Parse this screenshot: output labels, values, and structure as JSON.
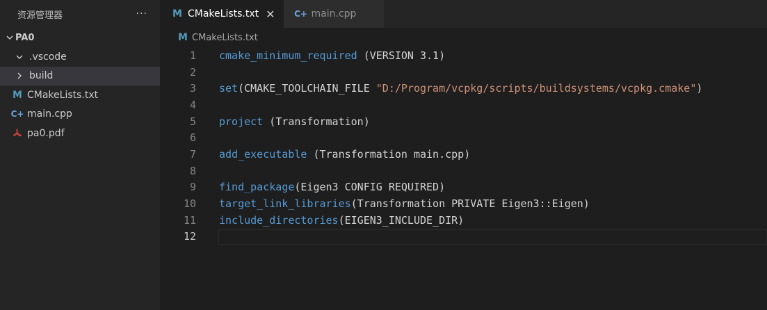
{
  "sidebar": {
    "title": "资源管理器",
    "more_label": "···",
    "folder_name": "PA0",
    "items": [
      {
        "label": ".vscode",
        "type": "folder"
      },
      {
        "label": "build",
        "type": "folder"
      },
      {
        "label": "CMakeLists.txt",
        "icon": "M"
      },
      {
        "label": "main.cpp",
        "icon": "C+"
      },
      {
        "label": "pa0.pdf",
        "icon": "pdf-icon"
      }
    ]
  },
  "tabs": [
    {
      "label": "CMakeLists.txt",
      "icon": "M",
      "active": true
    },
    {
      "label": "main.cpp",
      "icon": "C+",
      "active": false
    }
  ],
  "breadcrumb": {
    "label": "CMakeLists.txt",
    "icon": "M"
  },
  "editor": {
    "current_line": 12,
    "lines": [
      {
        "n": "1",
        "parts": [
          {
            "t": "cmake_minimum_required",
            "c": "kw"
          },
          {
            "t": " (VERSION 3.1)",
            "c": ""
          }
        ]
      },
      {
        "n": "2",
        "parts": []
      },
      {
        "n": "3",
        "parts": [
          {
            "t": "set",
            "c": "kw"
          },
          {
            "t": "(CMAKE_TOOLCHAIN_FILE ",
            "c": ""
          },
          {
            "t": "\"D:/Program/vcpkg/scripts/buildsystems/vcpkg.cmake\"",
            "c": "str"
          },
          {
            "t": ")",
            "c": ""
          }
        ]
      },
      {
        "n": "4",
        "parts": []
      },
      {
        "n": "5",
        "parts": [
          {
            "t": "project",
            "c": "kw"
          },
          {
            "t": " (Transformation)",
            "c": ""
          }
        ]
      },
      {
        "n": "6",
        "parts": []
      },
      {
        "n": "7",
        "parts": [
          {
            "t": "add_executable",
            "c": "kw"
          },
          {
            "t": " (Transformation main.cpp)",
            "c": ""
          }
        ]
      },
      {
        "n": "8",
        "parts": []
      },
      {
        "n": "9",
        "parts": [
          {
            "t": "find_package",
            "c": "kw"
          },
          {
            "t": "(Eigen3 CONFIG REQUIRED)",
            "c": ""
          }
        ]
      },
      {
        "n": "10",
        "parts": [
          {
            "t": "target_link_libraries",
            "c": "kw"
          },
          {
            "t": "(Transformation PRIVATE Eigen3::Eigen)",
            "c": ""
          }
        ]
      },
      {
        "n": "11",
        "parts": [
          {
            "t": "include_directories",
            "c": "kw"
          },
          {
            "t": "(EIGEN3_INCLUDE_DIR)",
            "c": ""
          }
        ]
      },
      {
        "n": "12",
        "parts": []
      }
    ]
  },
  "colors": {
    "keyword": "#569cd6",
    "string": "#ce9178",
    "cmake_icon": "#519aba",
    "cpp_icon": "#6ca2d8",
    "pdf_icon": "#d0453d"
  }
}
